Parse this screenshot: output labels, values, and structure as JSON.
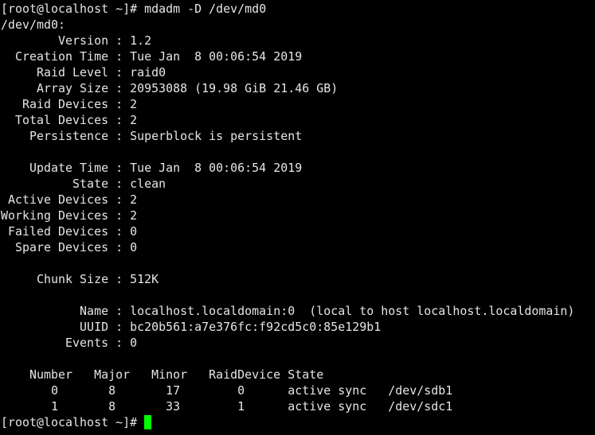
{
  "terminal": {
    "prompt": "[root@localhost ~]# ",
    "command": "mdadm -D /dev/md0",
    "device_header": "/dev/md0:",
    "fields": [
      {
        "label": "        Version",
        "value": "1.2"
      },
      {
        "label": "  Creation Time",
        "value": "Tue Jan  8 00:06:54 2019"
      },
      {
        "label": "     Raid Level",
        "value": "raid0"
      },
      {
        "label": "     Array Size",
        "value": "20953088 (19.98 GiB 21.46 GB)"
      },
      {
        "label": "   Raid Devices",
        "value": "2"
      },
      {
        "label": "  Total Devices",
        "value": "2"
      },
      {
        "label": "    Persistence",
        "value": "Superblock is persistent"
      },
      {
        "label": "",
        "value": ""
      },
      {
        "label": "    Update Time",
        "value": "Tue Jan  8 00:06:54 2019"
      },
      {
        "label": "          State",
        "value": "clean"
      },
      {
        "label": " Active Devices",
        "value": "2"
      },
      {
        "label": "Working Devices",
        "value": "2"
      },
      {
        "label": " Failed Devices",
        "value": "0"
      },
      {
        "label": "  Spare Devices",
        "value": "0"
      },
      {
        "label": "",
        "value": ""
      },
      {
        "label": "     Chunk Size",
        "value": "512K"
      },
      {
        "label": "",
        "value": ""
      },
      {
        "label": "           Name",
        "value": "localhost.localdomain:0  (local to host localhost.localdomain)"
      },
      {
        "label": "           UUID",
        "value": "bc20b561:a7e376fc:f92cd5c0:85e129b1"
      },
      {
        "label": "         Events",
        "value": "0"
      },
      {
        "label": "",
        "value": ""
      }
    ],
    "table_header": "    Number   Major   Minor   RaidDevice State",
    "table_rows": [
      "       0       8       17        0      active sync   /dev/sdb1",
      "       1       8       33        1      active sync   /dev/sdc1"
    ],
    "cursor_color": "#00ff00"
  }
}
